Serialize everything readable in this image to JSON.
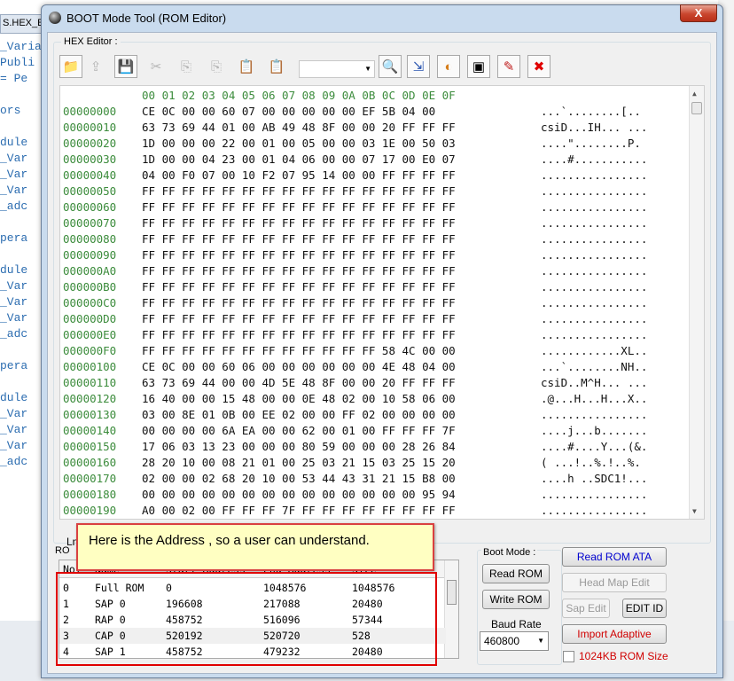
{
  "window": {
    "title": "BOOT Mode Tool (ROM Editor)",
    "close": "X"
  },
  "background": {
    "tab": "S.HEX_Ed",
    "code_lines": [
      "_Varia",
      "Publi",
      "= Pe",
      "",
      "ors",
      "",
      "dule",
      "_Var",
      "_Var",
      "_Var",
      "_adc",
      "",
      "pera",
      "",
      "dule",
      "_Var",
      "_Var",
      "_Var",
      "_adc",
      "",
      "pera",
      "",
      "dule",
      "_Var",
      "_Var",
      "_Var",
      "_adc"
    ]
  },
  "hex_editor": {
    "label": "HEX Editor :",
    "toolbar": [
      {
        "icon": "open-folder-icon",
        "glyph": "📁"
      },
      {
        "icon": "import-icon",
        "glyph": "⇪"
      },
      {
        "icon": "save-icon",
        "glyph": "💾"
      },
      {
        "icon": "cut-icon",
        "glyph": "✂"
      },
      {
        "icon": "copy-icon",
        "glyph": "⎘"
      },
      {
        "icon": "copy-hex-icon",
        "glyph": "⎘"
      },
      {
        "icon": "paste-icon",
        "glyph": "📋"
      },
      {
        "icon": "paste-special-icon",
        "glyph": "📋"
      },
      {
        "icon": "find-icon",
        "glyph": "🔍"
      },
      {
        "icon": "goto-icon",
        "glyph": "⇲"
      },
      {
        "icon": "refresh-icon",
        "glyph": "◐"
      },
      {
        "icon": "select-region-icon",
        "glyph": "▣"
      },
      {
        "icon": "clear-icon",
        "glyph": "✎"
      },
      {
        "icon": "close-file-icon",
        "glyph": "✖"
      }
    ],
    "combo_value": "",
    "header": "00 01 02 03 04 05 06 07 08 09 0A 0B 0C 0D 0E 0F",
    "rows": [
      {
        "addr": "00000000",
        "bytes": "CE 0C 00 00 60 07 00 00 00 00 00 EF 5B 04 00",
        "ascii": "...`........[.."
      },
      {
        "addr": "00000010",
        "bytes": "63 73 69 44 01 00 AB 49 48 8F 00 00 20 FF FF FF",
        "ascii": "csiD...IH... ..."
      },
      {
        "addr": "00000020",
        "bytes": "1D 00 00 00 22 00 01 00 05 00 00 03 1E 00 50 03",
        "ascii": "....\"........P."
      },
      {
        "addr": "00000030",
        "bytes": "1D 00 00 04 23 00 01 04 06 00 00 07 17 00 E0 07",
        "ascii": "....#..........."
      },
      {
        "addr": "00000040",
        "bytes": "04 00 F0 07 00 10 F2 07 95 14 00 00 FF FF FF FF",
        "ascii": "................"
      },
      {
        "addr": "00000050",
        "bytes": "FF FF FF FF FF FF FF FF FF FF FF FF FF FF FF FF",
        "ascii": "................"
      },
      {
        "addr": "00000060",
        "bytes": "FF FF FF FF FF FF FF FF FF FF FF FF FF FF FF FF",
        "ascii": "................"
      },
      {
        "addr": "00000070",
        "bytes": "FF FF FF FF FF FF FF FF FF FF FF FF FF FF FF FF",
        "ascii": "................"
      },
      {
        "addr": "00000080",
        "bytes": "FF FF FF FF FF FF FF FF FF FF FF FF FF FF FF FF",
        "ascii": "................"
      },
      {
        "addr": "00000090",
        "bytes": "FF FF FF FF FF FF FF FF FF FF FF FF FF FF FF FF",
        "ascii": "................"
      },
      {
        "addr": "000000A0",
        "bytes": "FF FF FF FF FF FF FF FF FF FF FF FF FF FF FF FF",
        "ascii": "................"
      },
      {
        "addr": "000000B0",
        "bytes": "FF FF FF FF FF FF FF FF FF FF FF FF FF FF FF FF",
        "ascii": "................"
      },
      {
        "addr": "000000C0",
        "bytes": "FF FF FF FF FF FF FF FF FF FF FF FF FF FF FF FF",
        "ascii": "................"
      },
      {
        "addr": "000000D0",
        "bytes": "FF FF FF FF FF FF FF FF FF FF FF FF FF FF FF FF",
        "ascii": "................"
      },
      {
        "addr": "000000E0",
        "bytes": "FF FF FF FF FF FF FF FF FF FF FF FF FF FF FF FF",
        "ascii": "................"
      },
      {
        "addr": "000000F0",
        "bytes": "FF FF FF FF FF FF FF FF FF FF FF FF 58 4C 00 00",
        "ascii": "............XL.."
      },
      {
        "addr": "00000100",
        "bytes": "CE 0C 00 00 60 06 00 00 00 00 00 00 4E 48 04 00",
        "ascii": "...`........NH.."
      },
      {
        "addr": "00000110",
        "bytes": "63 73 69 44 00 00 4D 5E 48 8F 00 00 20 FF FF FF",
        "ascii": "csiD..M^H... ..."
      },
      {
        "addr": "00000120",
        "bytes": "16 40 00 00 15 48 00 00 0E 48 02 00 10 58 06 00",
        "ascii": ".@...H...H...X.."
      },
      {
        "addr": "00000130",
        "bytes": "03 00 8E 01 0B 00 EE 02 00 00 FF 02 00 00 00 00",
        "ascii": "................"
      },
      {
        "addr": "00000140",
        "bytes": "00 00 00 00 6A EA 00 00 62 00 01 00 FF FF FF 7F",
        "ascii": "....j...b......."
      },
      {
        "addr": "00000150",
        "bytes": "17 06 03 13 23 00 00 00 80 59 00 00 00 28 26 84",
        "ascii": "....#....Y...(&."
      },
      {
        "addr": "00000160",
        "bytes": "28 20 10 00 08 21 01 00 25 03 21 15 03 25 15 20",
        "ascii": "( ...!..%.!..%. "
      },
      {
        "addr": "00000170",
        "bytes": "02 00 00 02 68 20 10 00 53 44 43 31 21 15 B8 00",
        "ascii": "....h ..SDC1!..."
      },
      {
        "addr": "00000180",
        "bytes": "00 00 00 00 00 00 00 00 00 00 00 00 00 00 95 94",
        "ascii": "................"
      },
      {
        "addr": "00000190",
        "bytes": "A0 00 02 00 FF FF FF 7F FF FF FF FF FF FF FF FF",
        "ascii": "................"
      }
    ],
    "line_info": "Ln"
  },
  "rom_table": {
    "group_label": "RO",
    "headers": [
      "No.",
      "Name",
      "Start Address",
      "End Address",
      "Size"
    ],
    "rows": [
      [
        "0",
        "Full ROM",
        "0",
        "1048576",
        "1048576"
      ],
      [
        "1",
        "SAP 0",
        "196608",
        "217088",
        "20480"
      ],
      [
        "2",
        "RAP 0",
        "458752",
        "516096",
        "57344"
      ],
      [
        "3",
        "CAP 0",
        "520192",
        "520720",
        "528"
      ],
      [
        "4",
        "SAP 1",
        "458752",
        "479232",
        "20480"
      ]
    ]
  },
  "callout": "Here is the Address , so a user can understand.",
  "boot_mode": {
    "label": "Boot Mode :",
    "read_rom": "Read ROM",
    "write_rom": "Write ROM",
    "baud_label": "Baud Rate",
    "baud_value": "460800"
  },
  "actions": {
    "read_rom_ata": "Read ROM ATA",
    "head_map_edit": "Head Map Edit",
    "sap_edit": "Sap Edit",
    "edit_id": "EDIT ID",
    "import_adaptive": "Import Adaptive",
    "rom_1024_label": "1024KB ROM Size"
  }
}
